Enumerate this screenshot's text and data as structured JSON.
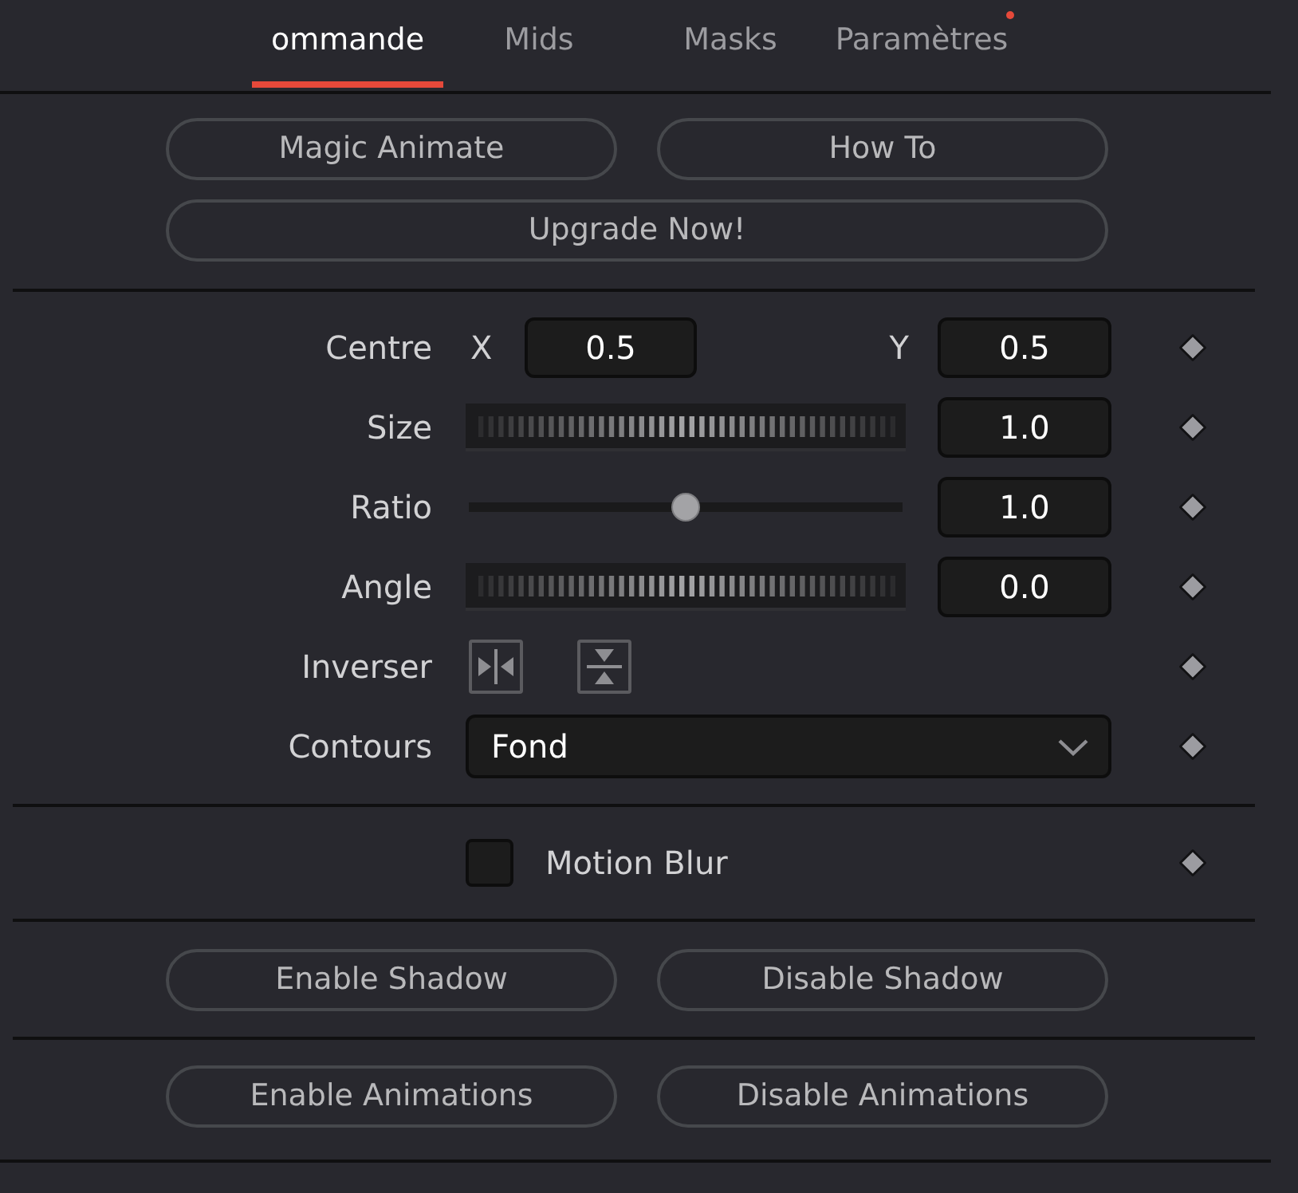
{
  "tabs": [
    {
      "label": "ommande",
      "selected": true,
      "badge": false
    },
    {
      "label": "Mids",
      "selected": false,
      "badge": false
    },
    {
      "label": "Masks",
      "selected": false,
      "badge": false
    },
    {
      "label": "Paramètres",
      "selected": false,
      "badge": true
    }
  ],
  "top_buttons": [
    "Magic Animate",
    "How To"
  ],
  "upgrade_button": "Upgrade Now!",
  "controls": [
    {
      "kind": "xy",
      "label": "Centre",
      "x_label": "X",
      "x_value": "0.5",
      "y_label": "Y",
      "y_value": "0.5"
    },
    {
      "kind": "jog",
      "label": "Size",
      "value": "1.0"
    },
    {
      "kind": "slider",
      "label": "Ratio",
      "level": 0.5,
      "value": "1.0"
    },
    {
      "kind": "jog",
      "label": "Angle",
      "value": "0.0"
    },
    {
      "kind": "flip",
      "label": "Inverser"
    },
    {
      "kind": "dropdown",
      "label": "Contours",
      "value": "Fond"
    }
  ],
  "motion_blur": {
    "label": "Motion Blur",
    "checked": false
  },
  "shadow_buttons": [
    "Enable Shadow",
    "Disable Shadow"
  ],
  "animation_buttons": [
    "Enable Animations",
    "Disable Animations"
  ]
}
